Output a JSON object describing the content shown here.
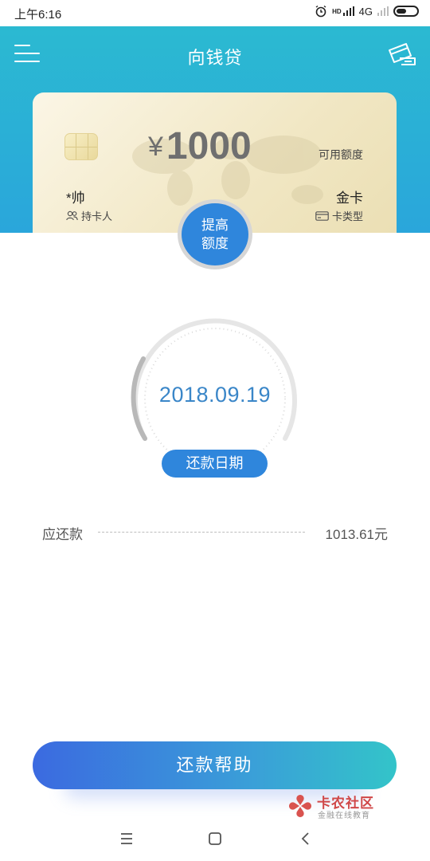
{
  "status_bar": {
    "time": "上午6:16",
    "hd_label": "HD",
    "network": "4G"
  },
  "nav": {
    "title": "向钱贷"
  },
  "card": {
    "currency_symbol": "¥",
    "available_amount": "1000",
    "available_label": "可用额度",
    "holder_name": "*帅",
    "holder_label": "持卡人",
    "card_type": "金卡",
    "card_type_label": "卡类型"
  },
  "raise_button": {
    "line1": "提高",
    "line2": "额度"
  },
  "due": {
    "date": "2018.09.19",
    "label": "还款日期"
  },
  "repayment": {
    "label": "应还款",
    "amount": "1013.61元"
  },
  "help_button": {
    "label": "还款帮助"
  },
  "watermark": {
    "title": "卡农社区",
    "subtitle": "金融在线教育"
  },
  "colors": {
    "header_top": "#2bbcd0",
    "header_bottom": "#2aa6db",
    "accent_blue": "#2f86dc",
    "date_text": "#3a86c8",
    "card_gold": "#f1e7c4"
  },
  "icons": {
    "menu": "hamburger-menu-icon",
    "card": "bank-card-icon",
    "holder": "people-icon",
    "card_type": "card-small-icon",
    "alarm": "alarm-clock-icon",
    "battery": "battery-icon"
  }
}
